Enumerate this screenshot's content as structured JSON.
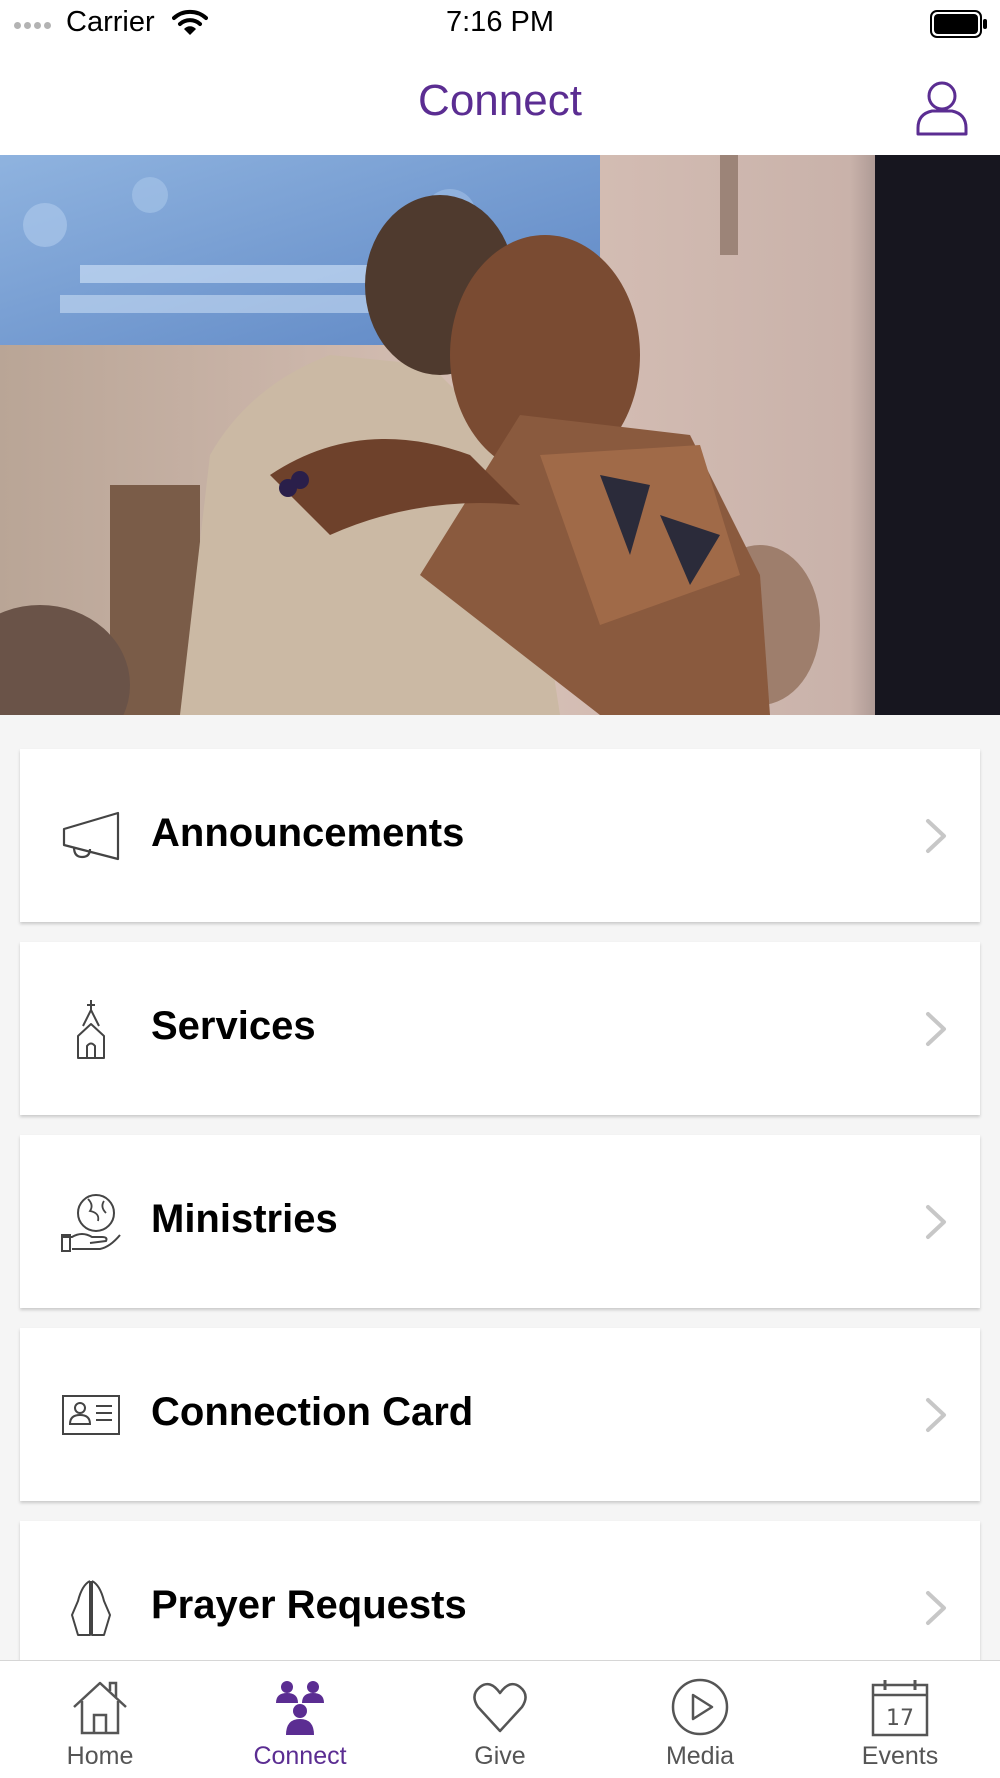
{
  "status_bar": {
    "carrier": "Carrier",
    "time": "7:16 PM",
    "wifi_icon": "wifi-icon",
    "battery_icon": "battery-icon"
  },
  "header": {
    "title": "Connect",
    "profile_icon": "user-profile-icon"
  },
  "hero": {
    "description_icon": "photo-image"
  },
  "menu": {
    "items": [
      {
        "label": "Announcements",
        "icon": "megaphone-icon"
      },
      {
        "label": "Services",
        "icon": "church-icon"
      },
      {
        "label": "Ministries",
        "icon": "globe-in-hand-icon"
      },
      {
        "label": "Connection Card",
        "icon": "id-card-icon"
      },
      {
        "label": "Prayer Requests",
        "icon": "praying-hands-icon"
      }
    ]
  },
  "tabs": {
    "items": [
      {
        "label": "Home",
        "icon": "home-icon"
      },
      {
        "label": "Connect",
        "icon": "people-icon",
        "active": true
      },
      {
        "label": "Give",
        "icon": "heart-icon"
      },
      {
        "label": "Media",
        "icon": "play-icon"
      },
      {
        "label": "Events",
        "icon": "calendar-icon",
        "calendar_day": "17"
      }
    ]
  },
  "colors": {
    "accent": "#5b2d92",
    "background": "#f5f5f5",
    "card": "#ffffff",
    "inactive_tab": "#555555",
    "chevron": "#c7c7c7"
  }
}
